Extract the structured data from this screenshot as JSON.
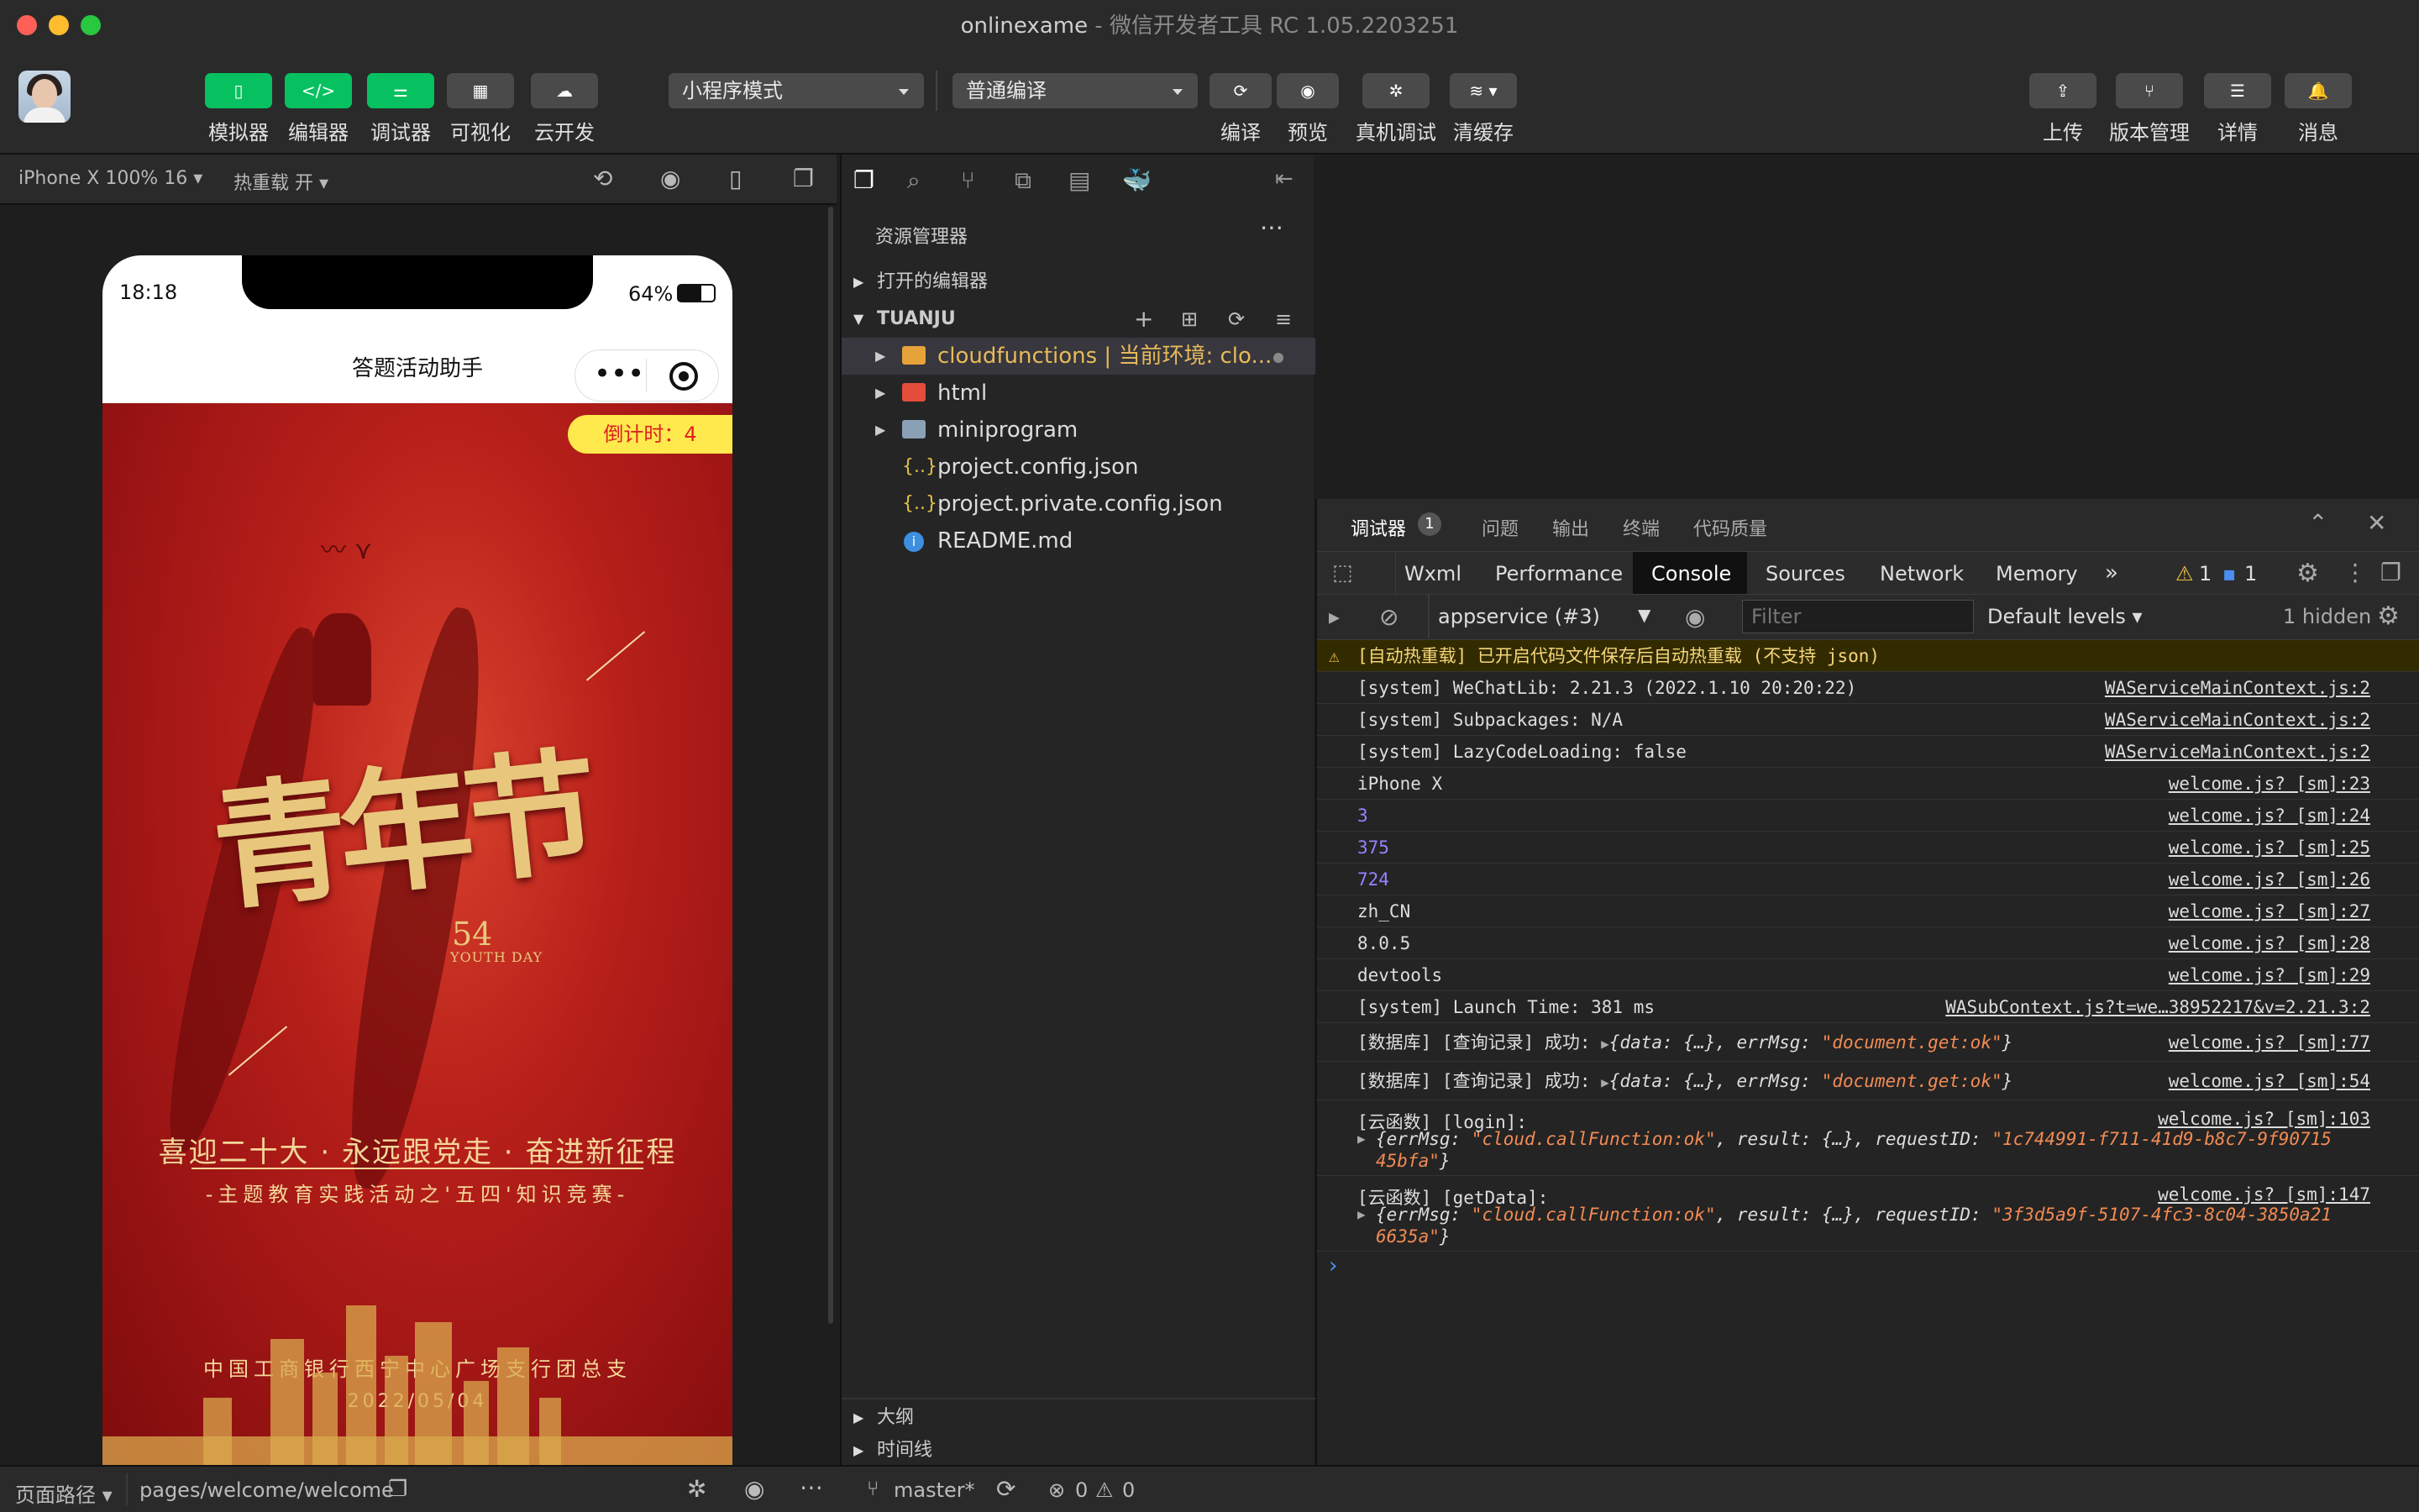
{
  "window": {
    "title": "onlinexame",
    "subtitle": "- 微信开发者工具 RC 1.05.2203251"
  },
  "toolbar": {
    "left_buttons": [
      {
        "label": "模拟器"
      },
      {
        "label": "编辑器"
      },
      {
        "label": "调试器"
      },
      {
        "label": "可视化"
      },
      {
        "label": "云开发"
      }
    ],
    "mode_select": "小程序模式",
    "compile_select": "普通编译",
    "mid_buttons": [
      {
        "label": "编译"
      },
      {
        "label": "预览"
      },
      {
        "label": "真机调试"
      },
      {
        "label": "清缓存"
      }
    ],
    "right_buttons": [
      {
        "label": "上传"
      },
      {
        "label": "版本管理"
      },
      {
        "label": "详情"
      },
      {
        "label": "消息"
      }
    ]
  },
  "simulator": {
    "device": "iPhone X 100% 16",
    "hot_reload": "热重载 开",
    "status_time": "18:18",
    "battery": "64%",
    "nav_title": "答题活动助手",
    "countdown": "倒计时：4",
    "poster_title": "青年节",
    "poster_number": "54",
    "poster_youth": "YOUTH DAY",
    "slogan": "喜迎二十大 · 永远跟党走 · 奋进新征程",
    "slogan2": "-主题教育实践活动之'五四'知识竞赛-",
    "bank": "中国工商银行西宁中心广场支行团总支",
    "date": "2022/05/04"
  },
  "explorer": {
    "title": "资源管理器",
    "open_editors": "打开的编辑器",
    "project": "TUANJU",
    "items": [
      {
        "label": "cloudfunctions | 当前环境: clo...",
        "type": "folder-cloud",
        "selected": true
      },
      {
        "label": "html",
        "type": "folder-html"
      },
      {
        "label": "miniprogram",
        "type": "folder"
      },
      {
        "label": "project.config.json",
        "type": "json"
      },
      {
        "label": "project.private.config.json",
        "type": "json"
      },
      {
        "label": "README.md",
        "type": "info"
      }
    ],
    "outline": "大纲",
    "timeline": "时间线"
  },
  "devtools": {
    "top_tabs": [
      {
        "label": "调试器",
        "badge": "1"
      },
      {
        "label": "问题"
      },
      {
        "label": "输出"
      },
      {
        "label": "终端"
      },
      {
        "label": "代码质量"
      }
    ],
    "tabs": [
      "Wxml",
      "Performance",
      "Console",
      "Sources",
      "Network",
      "Memory"
    ],
    "active_tab": "Console",
    "warn_count": "1",
    "info_count": "1",
    "context": "appservice (#3)",
    "filter_placeholder": "Filter",
    "levels": "Default levels",
    "hidden": "1 hidden",
    "logs": [
      {
        "msg": "[自动热重载] 已开启代码文件保存后自动热重载 (不支持 json)",
        "src": "",
        "kind": "warn"
      },
      {
        "msg": "[system] WeChatLib: 2.21.3 (2022.1.10 20:20:22)",
        "src": "WAServiceMainContext.js:2"
      },
      {
        "msg": "[system] Subpackages: N/A",
        "src": "WAServiceMainContext.js:2"
      },
      {
        "msg": "[system] LazyCodeLoading: false",
        "src": "WAServiceMainContext.js:2"
      },
      {
        "msg": "iPhone X",
        "src": "welcome.js? [sm]:23"
      },
      {
        "msg": "3",
        "src": "welcome.js? [sm]:24",
        "kind": "num"
      },
      {
        "msg": "375",
        "src": "welcome.js? [sm]:25",
        "kind": "num"
      },
      {
        "msg": "724",
        "src": "welcome.js? [sm]:26",
        "kind": "num"
      },
      {
        "msg": "zh_CN",
        "src": "welcome.js? [sm]:27"
      },
      {
        "msg": "8.0.5",
        "src": "welcome.js? [sm]:28"
      },
      {
        "msg": "devtools",
        "src": "welcome.js? [sm]:29"
      },
      {
        "msg": "[system] Launch Time: 381 ms",
        "src": "WASubContext.js?t=we…38952217&v=2.21.3:2"
      }
    ],
    "db_logs": [
      {
        "prefix": "[数据库] [查询记录] 成功: ",
        "obj_a": "{data: {…}, errMsg: ",
        "obj_str": "\"document.get:ok\"",
        "obj_b": "}",
        "src": "welcome.js? [sm]:77"
      },
      {
        "prefix": "[数据库] [查询记录] 成功: ",
        "obj_a": "{data: {…}, errMsg: ",
        "obj_str": "\"document.get:ok\"",
        "obj_b": "}",
        "src": "welcome.js? [sm]:54"
      }
    ],
    "cloud_logs": [
      {
        "head": "[云函数] [login]:",
        "src": "welcome.js? [sm]:103",
        "l1a": "{errMsg: ",
        "l1s": "\"cloud.callFunction:ok\"",
        "l1b": ", result: {…}, requestID: ",
        "l1r": "\"1c744991-f711-41d9-b8c7-9f90715",
        "l2": "45bfa\"",
        "l2b": "}"
      },
      {
        "head": "[云函数] [getData]:",
        "src": "welcome.js? [sm]:147",
        "l1a": "{errMsg: ",
        "l1s": "\"cloud.callFunction:ok\"",
        "l1b": ", result: {…}, requestID: ",
        "l1r": "\"3f3d5a9f-5107-4fc3-8c04-3850a21",
        "l2": "6635a\"",
        "l2b": "}"
      }
    ],
    "prompt": "›"
  },
  "statusbar": {
    "page_path_label": "页面路径",
    "page_path": "pages/welcome/welcome",
    "branch": "master*",
    "errors": "0",
    "warnings": "0"
  },
  "colors": {
    "brand_green": "#07c160",
    "poster_red": "#b8201a",
    "gold": "#e8c77d",
    "countdown_yellow": "#ffe94d"
  }
}
